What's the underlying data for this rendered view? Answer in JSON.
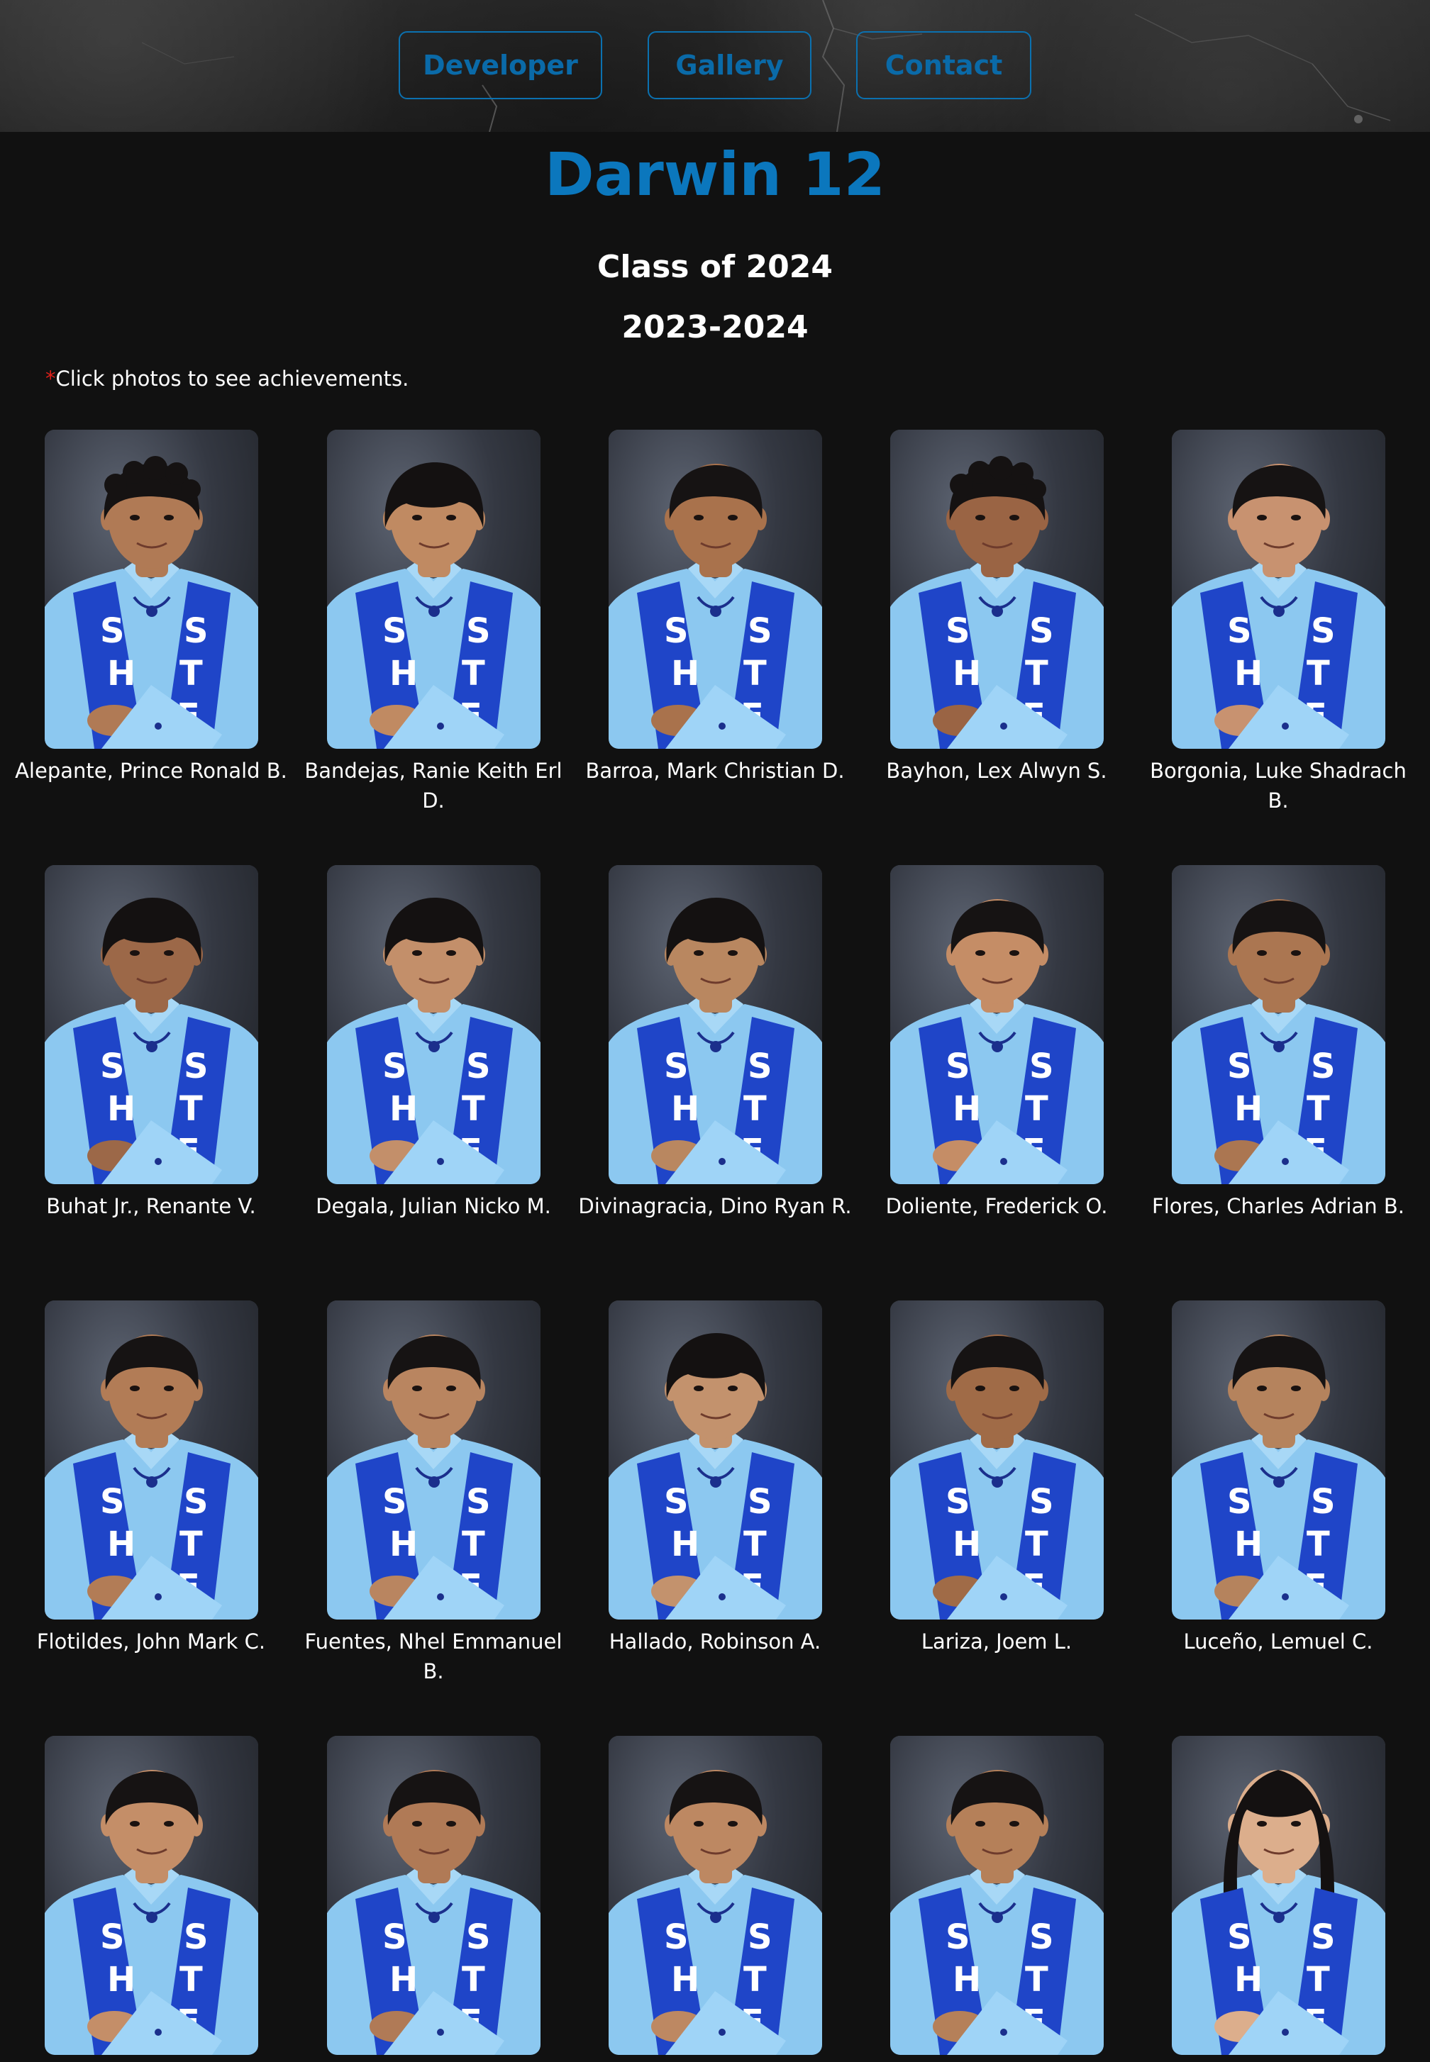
{
  "nav": {
    "developer_label": "Developer",
    "gallery_label": "Gallery",
    "contact_label": "Contact"
  },
  "title": "Darwin 12",
  "subtitle_class": "Class of 2024",
  "subtitle_year": "2023-2024",
  "note": {
    "asterisk": "*",
    "text": "Click photos to see achievements."
  },
  "colors": {
    "accent": "#0b77bd",
    "background": "#111111",
    "gown": "#8cc8f0",
    "sash": "#1f45c8"
  },
  "sash_letters": {
    "left": "SHS",
    "right": "STE"
  },
  "students": [
    {
      "name": "Alepante, Prince Ronald B.",
      "skin": "#b07a55",
      "hair": "curly"
    },
    {
      "name": "Bandejas, Ranie Keith Erl D.",
      "skin": "#c08a62",
      "hair": "fringe"
    },
    {
      "name": "Barroa, Mark Christian D.",
      "skin": "#a9724c",
      "hair": "short"
    },
    {
      "name": "Bayhon, Lex Alwyn S.",
      "skin": "#9a6444",
      "hair": "curly"
    },
    {
      "name": "Borgonia, Luke Shadrach B.",
      "skin": "#c89270",
      "hair": "short"
    },
    {
      "name": "Buhat Jr., Renante V.",
      "skin": "#9c6848",
      "hair": "fringe"
    },
    {
      "name": "Degala, Julian Nicko M.",
      "skin": "#c38f6a",
      "hair": "fringe"
    },
    {
      "name": "Divinagracia, Dino Ryan R.",
      "skin": "#b98760",
      "hair": "fringe"
    },
    {
      "name": "Doliente, Frederick O.",
      "skin": "#c58d66",
      "hair": "short"
    },
    {
      "name": "Flores, Charles Adrian B.",
      "skin": "#ab7651",
      "hair": "short"
    },
    {
      "name": "Flotildes, John Mark C.",
      "skin": "#b27c56",
      "hair": "short"
    },
    {
      "name": "Fuentes, Nhel Emmanuel B.",
      "skin": "#b98560",
      "hair": "short"
    },
    {
      "name": "Hallado, Robinson A.",
      "skin": "#c3926d",
      "hair": "fringe"
    },
    {
      "name": "Lariza, Joem L.",
      "skin": "#a06b47",
      "hair": "short"
    },
    {
      "name": "Luceño, Lemuel C.",
      "skin": "#b5835d",
      "hair": "short"
    },
    {
      "name": "",
      "skin": "#c48e68",
      "hair": "short"
    },
    {
      "name": "",
      "skin": "#b07a56",
      "hair": "short"
    },
    {
      "name": "",
      "skin": "#bd8862",
      "hair": "short"
    },
    {
      "name": "",
      "skin": "#b58059",
      "hair": "short"
    },
    {
      "name": "",
      "skin": "#dcae8c",
      "hair": "long"
    }
  ]
}
